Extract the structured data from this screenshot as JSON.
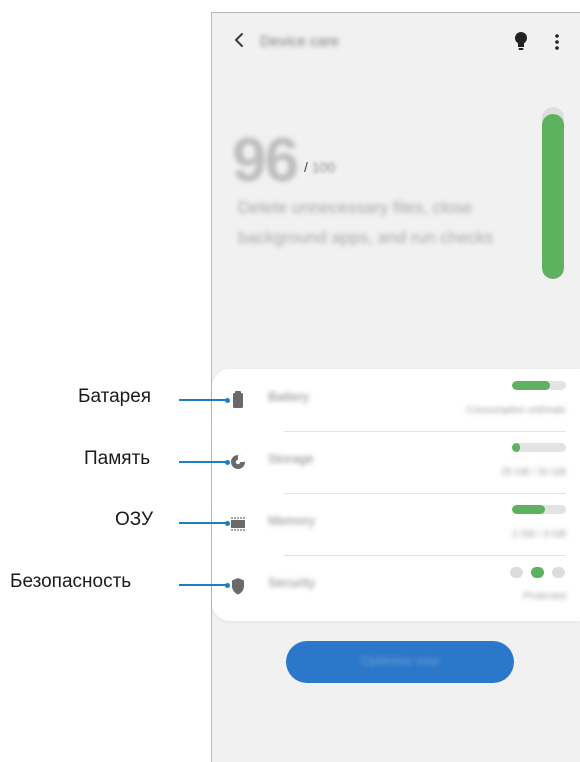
{
  "header": {
    "title": "Device care",
    "back_icon": "chevron-left-icon",
    "tips_icon": "lightbulb-icon",
    "more_icon": "more-vertical-icon"
  },
  "score": {
    "value": "96",
    "max": "100",
    "description": "Delete unnecessary files, close background apps, and run checks",
    "gauge_fraction": 0.96,
    "accent_color": "#5db15f"
  },
  "items": [
    {
      "label": "Battery",
      "value": "Consumption estimate",
      "icon": "battery-icon",
      "progress": 0.7
    },
    {
      "label": "Storage",
      "value": "25 GB / 32 GB",
      "icon": "storage-pie-icon",
      "progress": 0.15
    },
    {
      "label": "Memory",
      "value": "2 GB / 3 GB",
      "icon": "memory-chip-icon",
      "progress": 0.62
    },
    {
      "label": "Security",
      "value": "Protected",
      "icon": "shield-icon",
      "state": "middle"
    }
  ],
  "action": {
    "label": "Optimise now",
    "color": "#2b77c9"
  },
  "callouts": [
    "Батарея",
    "Память",
    "ОЗУ",
    "Безопасность"
  ],
  "callout_color": "#1d7fbf"
}
